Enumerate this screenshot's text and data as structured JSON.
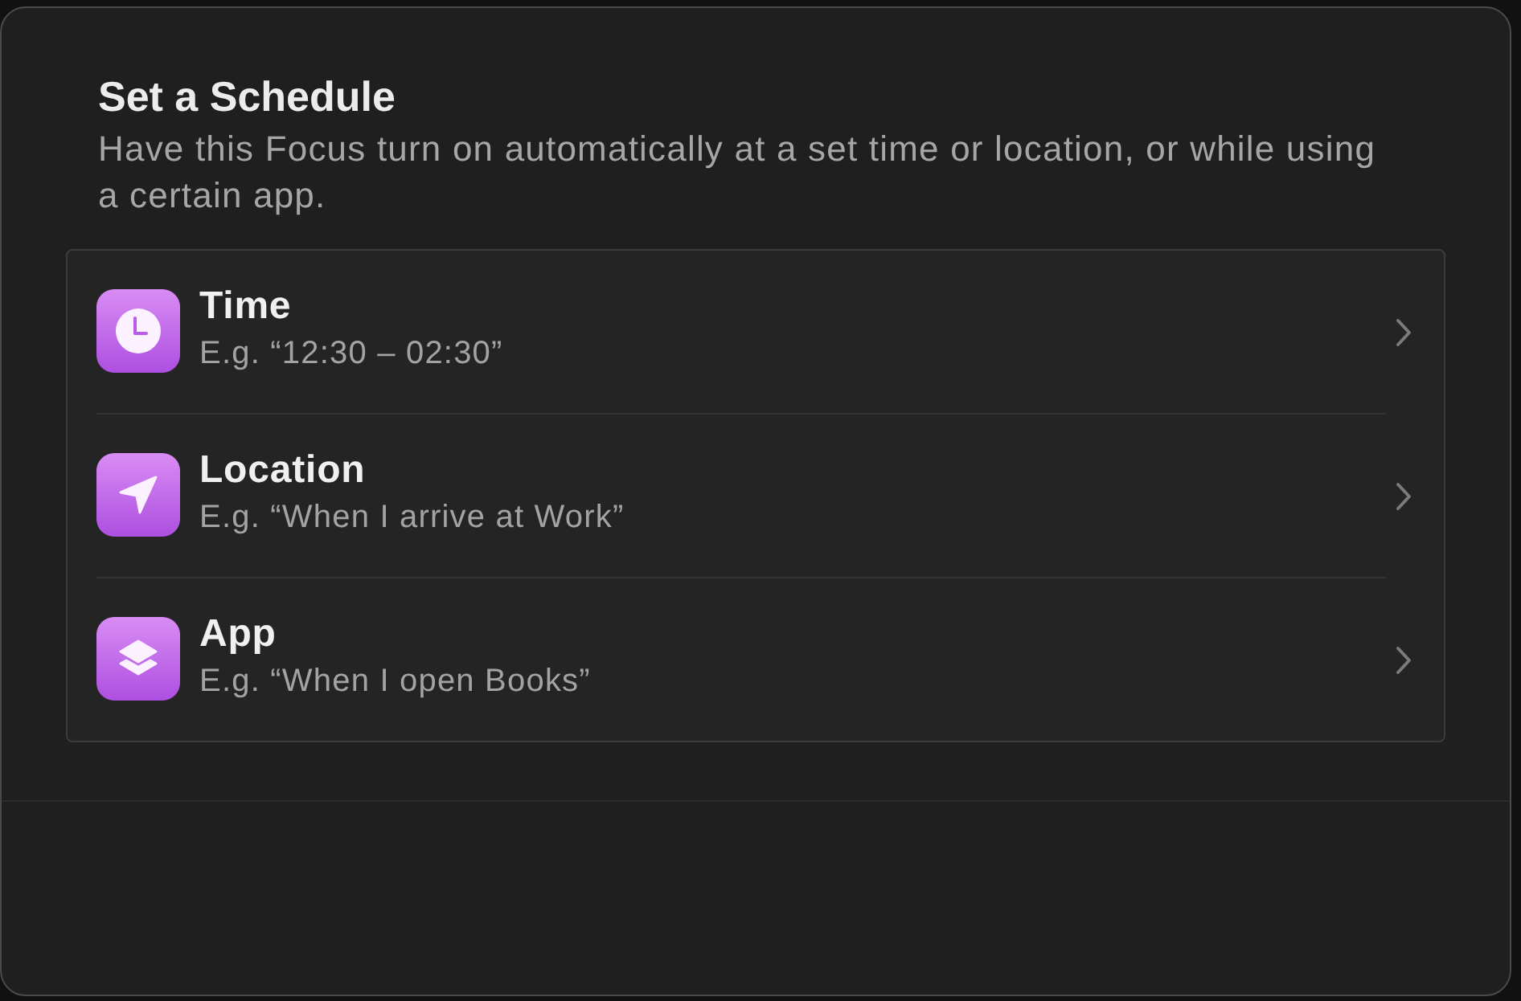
{
  "dialog": {
    "title": "Set a Schedule",
    "description": "Have this Focus turn on automatically at a set time or location, or while using a certain app."
  },
  "options": [
    {
      "kind": "time",
      "title": "Time",
      "example": "E.g. “12:30 – 02:30”"
    },
    {
      "kind": "location",
      "title": "Location",
      "example": "E.g. “When I arrive at Work”"
    },
    {
      "kind": "app",
      "title": "App",
      "example": "E.g. “When I open Books”"
    }
  ]
}
